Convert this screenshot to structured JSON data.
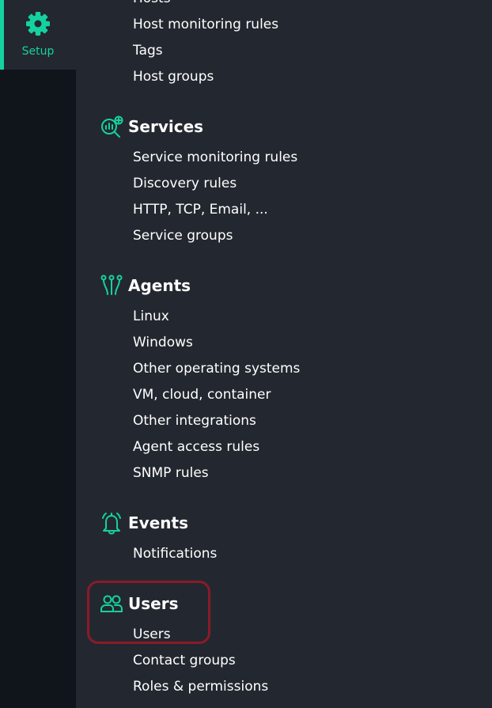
{
  "sidebar": {
    "setup_label": "Setup",
    "accent_color": "#15d1a0"
  },
  "menu": {
    "top_items": [
      "Hosts",
      "Host monitoring rules",
      "Tags",
      "Host groups"
    ],
    "sections": [
      {
        "title": "Services",
        "icon": "services-icon",
        "items": [
          "Service monitoring rules",
          "Discovery rules",
          "HTTP, TCP, Email, ...",
          "Service groups"
        ]
      },
      {
        "title": "Agents",
        "icon": "agents-icon",
        "items": [
          "Linux",
          "Windows",
          "Other operating systems",
          "VM, cloud, container",
          "Other integrations",
          "Agent access rules",
          "SNMP rules"
        ]
      },
      {
        "title": "Events",
        "icon": "bell-icon",
        "items": [
          "Notifications"
        ]
      },
      {
        "title": "Users",
        "icon": "users-icon",
        "items": [
          "Users",
          "Contact groups",
          "Roles & permissions"
        ]
      }
    ]
  },
  "highlight_color": "#8b1a2a"
}
